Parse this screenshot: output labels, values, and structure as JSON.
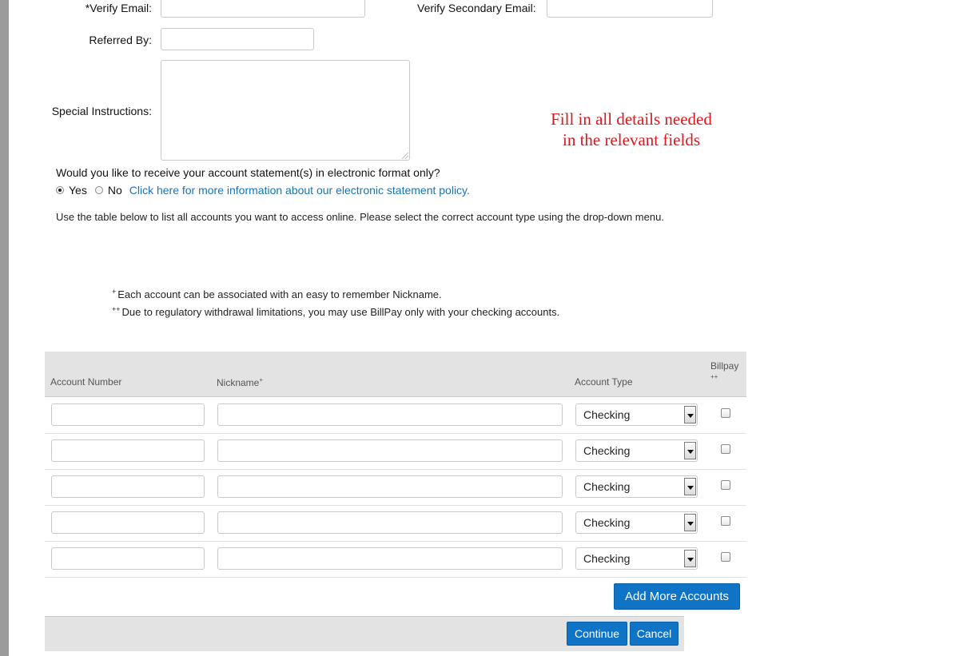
{
  "form": {
    "verify_email_label": "*Verify Email:",
    "verify_secondary_email_label": "Verify Secondary Email:",
    "referred_by_label": "Referred By:",
    "special_instructions_label": "Special Instructions:"
  },
  "annotation": {
    "line1": "Fill in all details needed",
    "line2": "in the relevant fields"
  },
  "estatement": {
    "question": "Would you like to receive your account statement(s) in electronic format only?",
    "yes_label": "Yes",
    "no_label": "No",
    "selected": "Yes",
    "policy_link": "Click here for more information about our electronic statement policy."
  },
  "instructions": "Use the table below to list all accounts you want to access online. Please select the correct account type using the drop-down menu.",
  "footnotes": {
    "note1_marker": "+",
    "note1": "Each account can be associated with an easy to remember Nickname.",
    "note2_marker": "++",
    "note2": "Due to regulatory withdrawal limitations, you may use BillPay only with your checking accounts."
  },
  "table": {
    "headers": {
      "account_number": "Account Number",
      "nickname": "Nickname",
      "nickname_marker": "+",
      "account_type": "Account Type",
      "billpay": "Billpay",
      "billpay_marker": "++"
    },
    "rows": [
      {
        "account_type": "Checking"
      },
      {
        "account_type": "Checking"
      },
      {
        "account_type": "Checking"
      },
      {
        "account_type": "Checking"
      },
      {
        "account_type": "Checking"
      }
    ]
  },
  "buttons": {
    "add_more": "Add More Accounts",
    "continue": "Continue",
    "cancel": "Cancel"
  },
  "colors": {
    "accent": "#0f74c6",
    "annotation": "#e0161c",
    "link": "#1a73b5"
  }
}
